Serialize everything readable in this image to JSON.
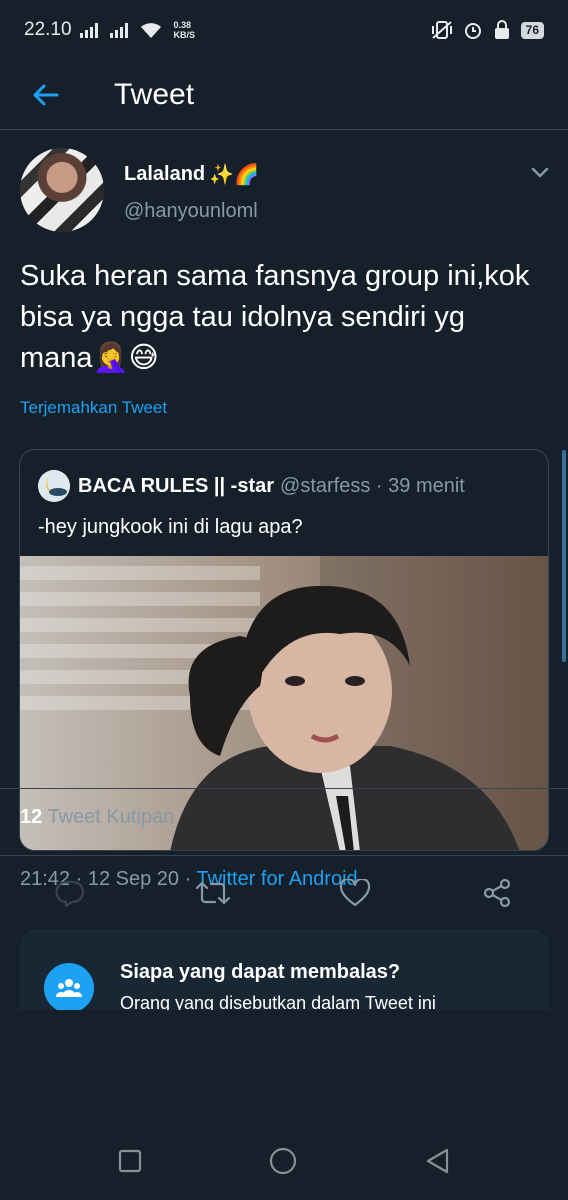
{
  "status_bar": {
    "time": "22.10",
    "speed_value": "0.38",
    "speed_unit": "KB/S",
    "battery": "76"
  },
  "header": {
    "title": "Tweet"
  },
  "tweet": {
    "name": "Lalaland",
    "name_emoji": "✨🌈",
    "handle": "@hanyounloml",
    "text": "Suka heran sama fansnya group ini,kok bisa ya ngga tau idolnya sendiri yg mana🤦‍♀️😅",
    "translate": "Terjemahkan Tweet",
    "time": "21:42",
    "date": "12 Sep 20",
    "client": "Twitter for Android"
  },
  "quote": {
    "name": "BACA RULES || -star",
    "handle": "@starfess",
    "time_ago": "39 menit",
    "text": "-hey jungkook ini di lagu apa?"
  },
  "stats": {
    "quote_count": "12",
    "quote_label": "Tweet Kutipan"
  },
  "reply_card": {
    "title": "Siapa yang dapat membalas?",
    "subtitle": "Orang yang disebutkan dalam Tweet ini"
  },
  "colors": {
    "background": "#15202b",
    "accent": "#1da1f2",
    "muted": "#8899a6",
    "border": "#38444d"
  }
}
